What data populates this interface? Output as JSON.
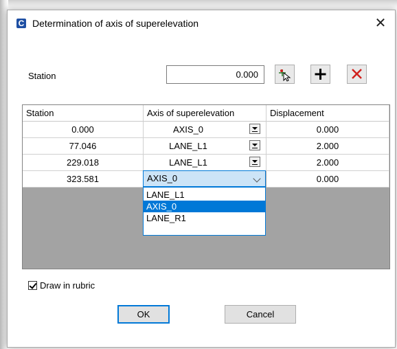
{
  "window": {
    "title": "Determination of axis of superelevation",
    "app_icon_letter": "C",
    "close_glyph": "✕"
  },
  "station": {
    "label": "Station",
    "value": "0.000"
  },
  "toolbar": {
    "pick_icon": "pick-station-icon",
    "add_icon": "plus-icon",
    "delete_icon": "delete-x-icon"
  },
  "table": {
    "columns": [
      "Station",
      "Axis of superelevation",
      "Displacement"
    ],
    "rows": [
      {
        "station": "0.000",
        "axis": "AXIS_0",
        "displacement": "0.000"
      },
      {
        "station": "77.046",
        "axis": "LANE_L1",
        "displacement": "2.000"
      },
      {
        "station": "229.018",
        "axis": "LANE_L1",
        "displacement": "2.000"
      },
      {
        "station": "323.581",
        "axis": "AXIS_0",
        "displacement": "0.000"
      }
    ],
    "open_dropdown": {
      "row": 3,
      "options": [
        "LANE_L1",
        "AXIS_0",
        "LANE_R1"
      ],
      "selected": "AXIS_0"
    }
  },
  "options": {
    "draw_in_rubric_label": "Draw in rubric",
    "draw_in_rubric_checked": true
  },
  "buttons": {
    "ok": "OK",
    "cancel": "Cancel"
  },
  "colors": {
    "accent": "#0078d7",
    "grid_empty": "#a3a3a3",
    "delete_red": "#d0201c"
  }
}
